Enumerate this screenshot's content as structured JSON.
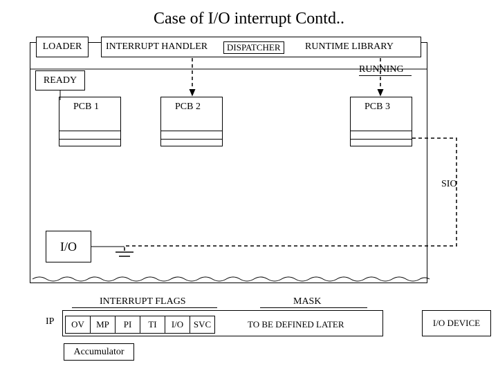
{
  "title": "Case of I/O interrupt Contd..",
  "os_header": {
    "loader": "LOADER",
    "interrupt_handler": "INTERRUPT HANDLER",
    "dispatcher": "DISPATCHER",
    "runtime_library": "RUNTIME LIBRARY"
  },
  "states": {
    "ready": "READY",
    "running": "RUNNING"
  },
  "pcbs": {
    "pcb1": "PCB 1",
    "pcb2": "PCB 2",
    "pcb3": "PCB 3"
  },
  "io_block": "I/O",
  "sio_label": "SIO",
  "ip": {
    "label": "IP",
    "flags_title": "INTERRUPT FLAGS",
    "flags": [
      "OV",
      "MP",
      "PI",
      "TI",
      "I/O",
      "SVC"
    ],
    "mask_title": "MASK",
    "mask_text": "TO BE DEFINED LATER",
    "accumulator": "Accumulator"
  },
  "io_device": "I/O DEVICE"
}
